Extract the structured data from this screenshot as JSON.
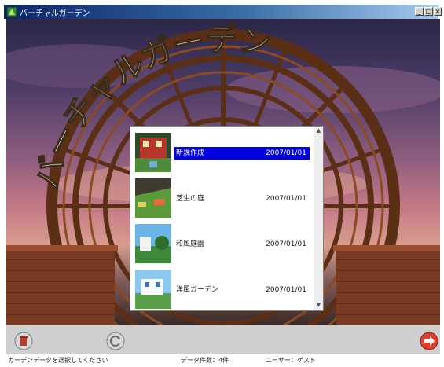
{
  "window": {
    "title": "バーチャルガーデン",
    "buttons": {
      "minimize": "_",
      "maximize": "□",
      "close": "×"
    }
  },
  "scene": {
    "banner_title": "バーチャルガーデン"
  },
  "list": {
    "items": [
      {
        "name": "新規作成",
        "date": "2007/01/01",
        "selected": true
      },
      {
        "name": "芝生の庭",
        "date": "2007/01/01",
        "selected": false
      },
      {
        "name": "和風庭園",
        "date": "2007/01/01",
        "selected": false
      },
      {
        "name": "洋風ガーデン",
        "date": "2007/01/01",
        "selected": false
      }
    ],
    "scroll_up": "▲",
    "scroll_down": "▼"
  },
  "toolbar": {
    "icons": [
      "delete-icon",
      "reload-icon",
      "next-arrow-icon"
    ]
  },
  "statusbar": {
    "left": "ガーデンデータを選択してください",
    "middle": "データ件数：4件",
    "right": "ユーザー：ゲスト"
  }
}
